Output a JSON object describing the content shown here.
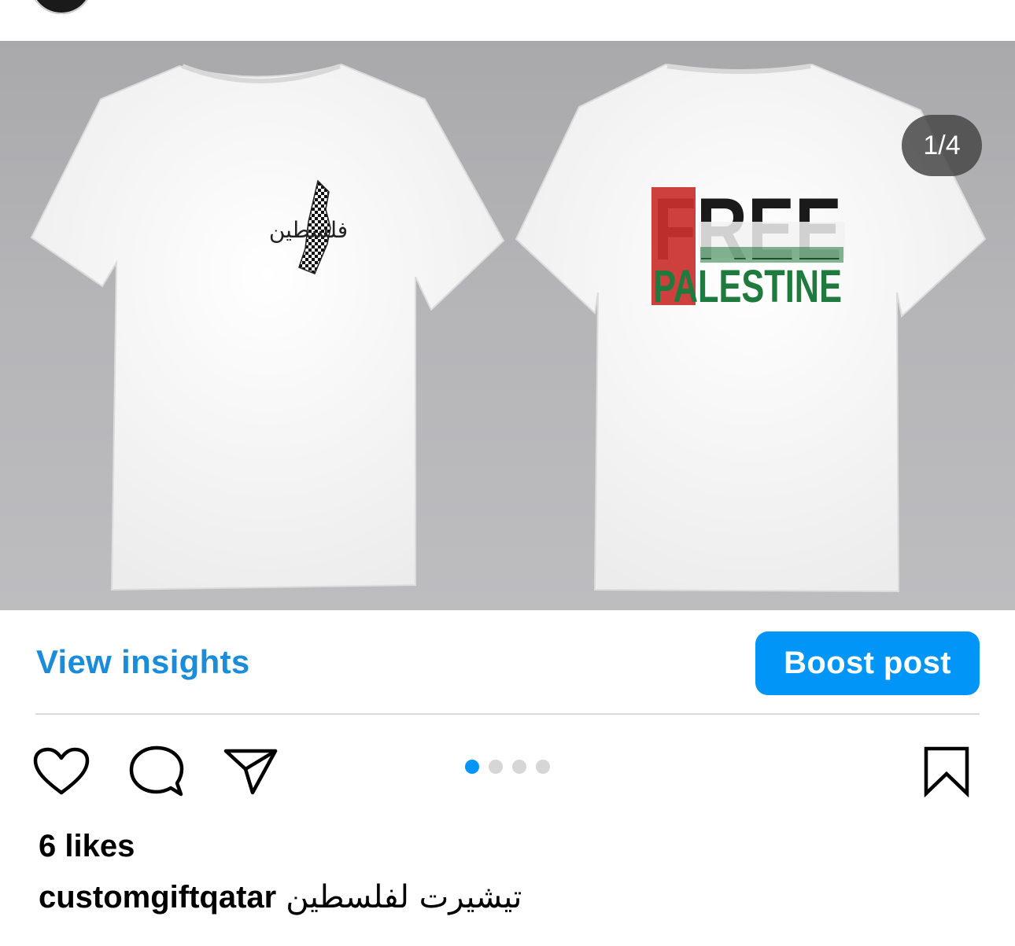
{
  "post": {
    "media": {
      "counter": "1/4",
      "left_print_text": "فلسطين",
      "right_print_line1": "FREE",
      "right_print_line2": "PALESTINE"
    },
    "insights_label": "View insights",
    "boost_label": "Boost post",
    "carousel": {
      "total": 4,
      "active": 1
    },
    "likes": "6 likes",
    "caption": {
      "username": "customgiftqatar",
      "text": "تيشيرت لفلسطين"
    }
  },
  "colors": {
    "link": "#1a8cd8",
    "boost_bg": "#0095f6",
    "dot_active": "#0095f6",
    "dot_inactive": "#d6d6d6"
  },
  "icons": [
    "heart-icon",
    "comment-icon",
    "share-icon",
    "bookmark-icon"
  ]
}
